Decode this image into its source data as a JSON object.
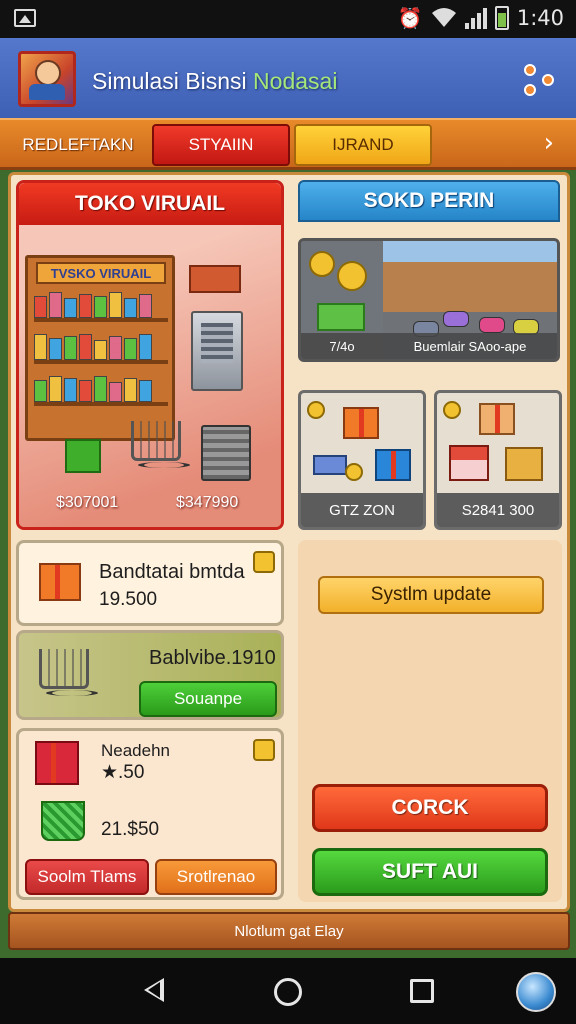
{
  "status_bar": {
    "time": "1:40"
  },
  "app_bar": {
    "title_main": "Simulasi Bisnsi ",
    "title_accent": "Nodasai"
  },
  "tabs": [
    {
      "label": "REDLEFTAKN"
    },
    {
      "label": "STYAIIN"
    },
    {
      "label": "IJRAND"
    }
  ],
  "tab_arrow": "›",
  "store": {
    "title": "TOKO VIRUAIL",
    "shelf_sign": "TVSKO VIRUAIL",
    "price_left": "$307001",
    "price_right": "$347990"
  },
  "street": {
    "title": "SOKD PERIN",
    "caption_left": "7/4o",
    "caption_right": "Buemlair SAoo-ape"
  },
  "item_tiles": [
    {
      "label": "GTZ ZON"
    },
    {
      "label": "S2841 300"
    }
  ],
  "list_cards": [
    {
      "title": "Bandtatai bmtda",
      "value": "19.500"
    },
    {
      "title": "Bablvibe.1910",
      "button": "Souanpe"
    },
    {
      "title": "Neadehn",
      "value_top": "★.50",
      "value_bottom": "21.$50",
      "button_left": "Soolm Tlams",
      "button_right": "Srotlrenao"
    }
  ],
  "right_panel": {
    "system_update": "Systlm update",
    "primary_button": "CORCK",
    "secondary_button": "SUFT AUI"
  },
  "footer": {
    "text": "Nlotlum gat Elay"
  },
  "colors": {
    "accent_red": "#c71b13",
    "accent_blue": "#2585c8",
    "accent_green": "#2a9c1c",
    "accent_orange": "#e0701a",
    "app_bar": "#3e60b4"
  }
}
